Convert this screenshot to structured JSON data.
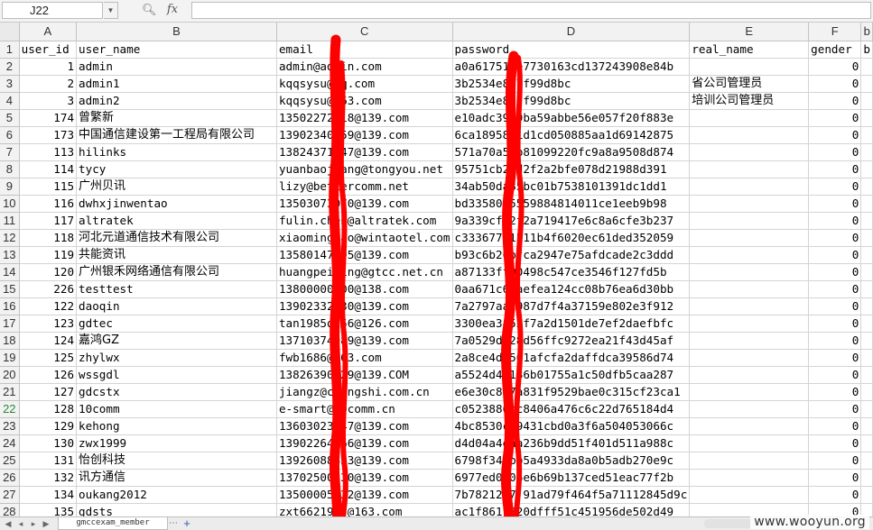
{
  "formula_bar": {
    "cell_ref": "J22",
    "zoom_icon": "magnifier-icon",
    "fx_label": "fx",
    "formula_value": ""
  },
  "columns": [
    "A",
    "B",
    "C",
    "D",
    "E",
    "F",
    "b"
  ],
  "headers": [
    "user_id",
    "user_name",
    "email",
    "password",
    "real_name",
    "gender",
    "b"
  ],
  "rows": [
    {
      "n": "2",
      "id": "1",
      "name": "admin",
      "email": "admin@admin.com",
      "password": "a0a617517e7730163cd137243908e84b",
      "real_name": "",
      "gender": "0"
    },
    {
      "n": "3",
      "id": "2",
      "name": "admin1",
      "email": "kqqsysu@qq.com",
      "password": "3b2534e837f99d8bc",
      "real_name": "省公司管理员",
      "gender": "0"
    },
    {
      "n": "4",
      "id": "3",
      "name": "admin2",
      "email": "kqqsysu@163.com",
      "password": "3b2534e837f99d8bc",
      "real_name": "培训公司管理员",
      "gender": "0"
    },
    {
      "n": "5",
      "id": "174",
      "name": "曾繁新",
      "email": "13502272118@139.com",
      "password": "e10adc3949ba59abbe56e057f20f883e",
      "real_name": "",
      "gender": "0"
    },
    {
      "n": "6",
      "id": "173",
      "name": "中国通信建设第一工程局有限公司",
      "email": "13902340159@139.com",
      "password": "6ca1895821d1cd050885aa1d69142875",
      "real_name": "",
      "gender": "0"
    },
    {
      "n": "7",
      "id": "113",
      "name": "hilinks",
      "email": "13824371347@139.com",
      "password": "571a70a58b81099220fc9a8a9508d874",
      "real_name": "",
      "gender": "0"
    },
    {
      "n": "8",
      "id": "114",
      "name": "tycy",
      "email": "yuanbaojiang@tongyou.net",
      "password": "95751cb24d2f2a2bfe078d21988d391",
      "real_name": "",
      "gender": "0"
    },
    {
      "n": "9",
      "id": "115",
      "name": "广州贝讯",
      "email": "lizy@bettercomm.net",
      "password": "34ab50da85bc01b7538101391dc1dd1",
      "real_name": "",
      "gender": "0"
    },
    {
      "n": "10",
      "id": "116",
      "name": "dwhxjinwentao",
      "email": "13503073070@139.com",
      "password": "bd33580e5559884814011ce1eeb9b98",
      "real_name": "",
      "gender": "0"
    },
    {
      "n": "11",
      "id": "117",
      "name": "altratek",
      "email": "fulin.chen@altratek.com",
      "password": "9a339cfe2f2a719417e6c8a6cfe3b237",
      "real_name": "",
      "gender": "0"
    },
    {
      "n": "12",
      "id": "118",
      "name": "河北元道通信技术有限公司",
      "email": "xiaomingtao@wintaotel.com",
      "password": "c33367701511b4f6020ec61ded352059",
      "real_name": "",
      "gender": "0"
    },
    {
      "n": "13",
      "id": "119",
      "name": "共能资讯",
      "email": "13580147995@139.com",
      "password": "b93c6b26bfca2947e75afdcade2c3ddd",
      "real_name": "",
      "gender": "0"
    },
    {
      "n": "14",
      "id": "120",
      "name": "广州银禾网络通信有限公司",
      "email": "huangpeiying@gtcc.net.cn",
      "password": "a87133ff00498c547ce3546f127fd5b",
      "real_name": "",
      "gender": "0"
    },
    {
      "n": "15",
      "id": "226",
      "name": "testtest",
      "email": "13800000000@138.com",
      "password": "0aa671c66aefea124cc08b76ea6d30bb",
      "real_name": "",
      "gender": "0"
    },
    {
      "n": "16",
      "id": "122",
      "name": "daoqin",
      "email": "13902332830@139.com",
      "password": "7a2797aac987d7f4a37159e802e3f912",
      "real_name": "",
      "gender": "0"
    },
    {
      "n": "17",
      "id": "123",
      "name": "gdtec",
      "email": "tan1985qi56@126.com",
      "password": "3300ea3452f7a2d1501de7ef2daefbfc",
      "real_name": "",
      "gender": "0"
    },
    {
      "n": "18",
      "id": "124",
      "name": "嘉鸿GZ",
      "email": "13710374989@139.com",
      "password": "7a0529dc28d56ffc9272ea21f43d45af",
      "real_name": "",
      "gender": "0"
    },
    {
      "n": "19",
      "id": "125",
      "name": "zhylwx",
      "email": "fwb1686@163.com",
      "password": "2a8ce4da561afcfa2daffdca39586d74",
      "real_name": "",
      "gender": "0"
    },
    {
      "n": "20",
      "id": "126",
      "name": "wssgdl",
      "email": "13826390129@139.COM",
      "password": "a5524d4f186b01755a1c50dfb5caa287",
      "real_name": "",
      "gender": "0"
    },
    {
      "n": "21",
      "id": "127",
      "name": "gdcstx",
      "email": "jiangz@changshi.com.cn",
      "password": "e6e30c887a831f9529bae0c315cf23ca1",
      "real_name": "",
      "gender": "0"
    },
    {
      "n": "22",
      "id": "128",
      "name": "10comm",
      "email": "e-smart@10comm.cn",
      "password": "c0523886cc8406a476c6c22d765184d4",
      "real_name": "",
      "gender": "0"
    },
    {
      "n": "23",
      "id": "129",
      "name": "kehong",
      "email": "13603023047@139.com",
      "password": "4bc8530c19431cbd0a3f6a504053066c",
      "real_name": "",
      "gender": "0"
    },
    {
      "n": "24",
      "id": "130",
      "name": "zwx1999",
      "email": "13902264066@139.com",
      "password": "d4d04a4eaa236b9dd51f401d511a988c",
      "real_name": "",
      "gender": "0"
    },
    {
      "n": "25",
      "id": "131",
      "name": "怡创科技",
      "email": "13926088823@139.com",
      "password": "6798f346bb5a4933da8a0b5adb270e9c",
      "real_name": "",
      "gender": "0"
    },
    {
      "n": "26",
      "id": "132",
      "name": "讯方通信",
      "email": "13702500330@139.com",
      "password": "6977ed0b06e6b69b137ced51eac77f2b",
      "real_name": "",
      "gender": "0"
    },
    {
      "n": "27",
      "id": "134",
      "name": "oukang2012",
      "email": "13500005132@139.com",
      "password": "7b7821217 91ad79f464f5a71112845d9c",
      "real_name": "",
      "gender": "0"
    },
    {
      "n": "28",
      "id": "135",
      "name": "gdsts",
      "email": "zxt6621995@163.com",
      "password": "ac1f861f320dfff51c451956de502d49",
      "real_name": "",
      "gender": "0"
    }
  ],
  "tabbar": {
    "sheet_name": "gmccexam_member",
    "add_icon": "plus-icon",
    "nav_first": "◀",
    "nav_last": "▶"
  },
  "watermark": "www.wooyun.org",
  "colors": {
    "redaction": "#ff0000",
    "active_row_header": "#2a8a3d",
    "header_bg": "#f2f2f2",
    "grid_line": "#d4d4d4"
  }
}
